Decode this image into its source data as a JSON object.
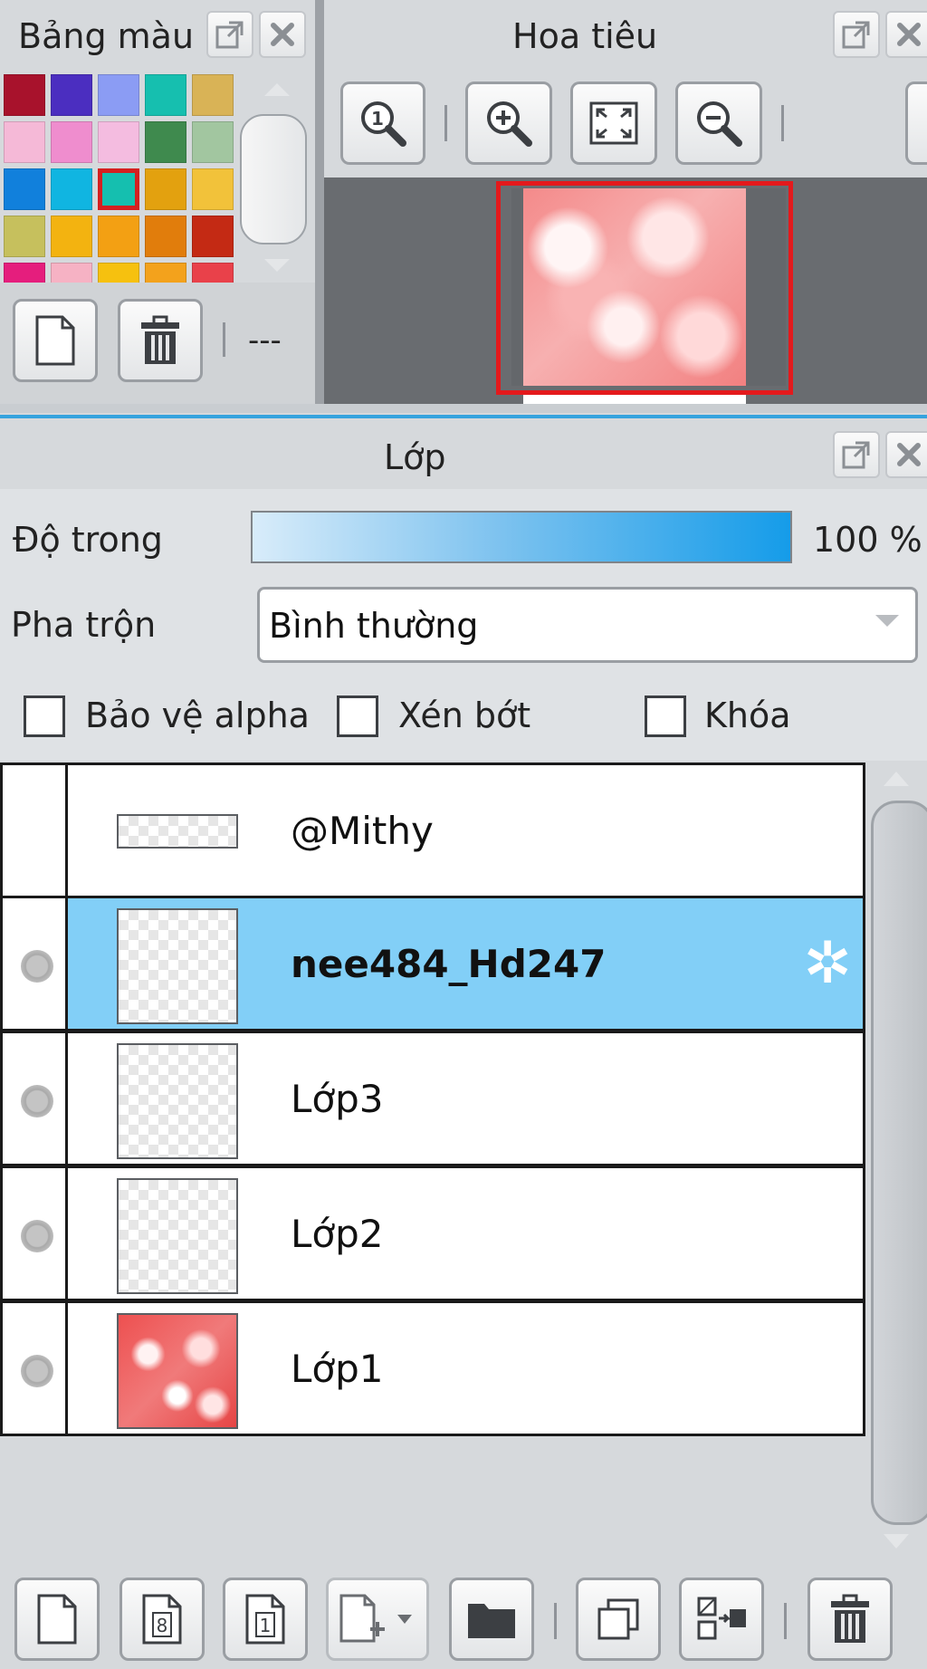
{
  "palette": {
    "title": "Bảng màu",
    "swatches": [
      [
        "#a8122c",
        "#4b2ec0",
        "#8b9cf4",
        "#16bfaf",
        "#d9b356"
      ],
      [
        "#f5b9d7",
        "#ef8dce",
        "#f4bce0",
        "#3f8a4e",
        "#a2c6a0"
      ],
      [
        "#1180dc",
        "#10b5e1",
        "#15bfaf",
        "#e3a10f",
        "#f2c23a"
      ],
      [
        "#c6c05d",
        "#f3b310",
        "#f3a013",
        "#e17d0c",
        "#c42a14"
      ],
      [
        "#e51e7d",
        "#f6b2c4",
        "#f6c10f",
        "#f3a21c",
        "#e9414a"
      ]
    ],
    "selected_swatch": "2-2",
    "more_label": "---"
  },
  "navigator": {
    "title": "Hoa tiêu"
  },
  "layers": {
    "title": "Lớp",
    "opacity_label": "Độ trong",
    "opacity_value": "100 %",
    "opacity_fraction": 1.0,
    "blend_label": "Pha trộn",
    "blend_value": "Bình thường",
    "checkbox_alpha": "Bảo vệ alpha",
    "checkbox_clip": "Xén bớt",
    "checkbox_lock": "Khóa",
    "items": [
      {
        "name": "@Mithy",
        "thumb": "text",
        "active": false,
        "visible_dot": false
      },
      {
        "name": "nee484_Hd247",
        "thumb": "blank",
        "active": true,
        "visible_dot": true
      },
      {
        "name": "Lớp3",
        "thumb": "blank",
        "active": false,
        "visible_dot": true
      },
      {
        "name": "Lớp2",
        "thumb": "blank",
        "active": false,
        "visible_dot": true
      },
      {
        "name": "Lớp1",
        "thumb": "red",
        "active": false,
        "visible_dot": true
      }
    ],
    "bottom_icons": [
      "new-layer-icon",
      "8bit-layer-icon",
      "1bit-layer-icon",
      "add-layer-menu-icon",
      "folder-icon",
      "duplicate-icon",
      "merge-down-icon",
      "trash-icon"
    ],
    "bit8_label": "8",
    "bit1_label": "1"
  },
  "colors": {
    "accent": "#35a3de",
    "selected_row": "#82cff7",
    "nav_frame": "#e4191c"
  }
}
